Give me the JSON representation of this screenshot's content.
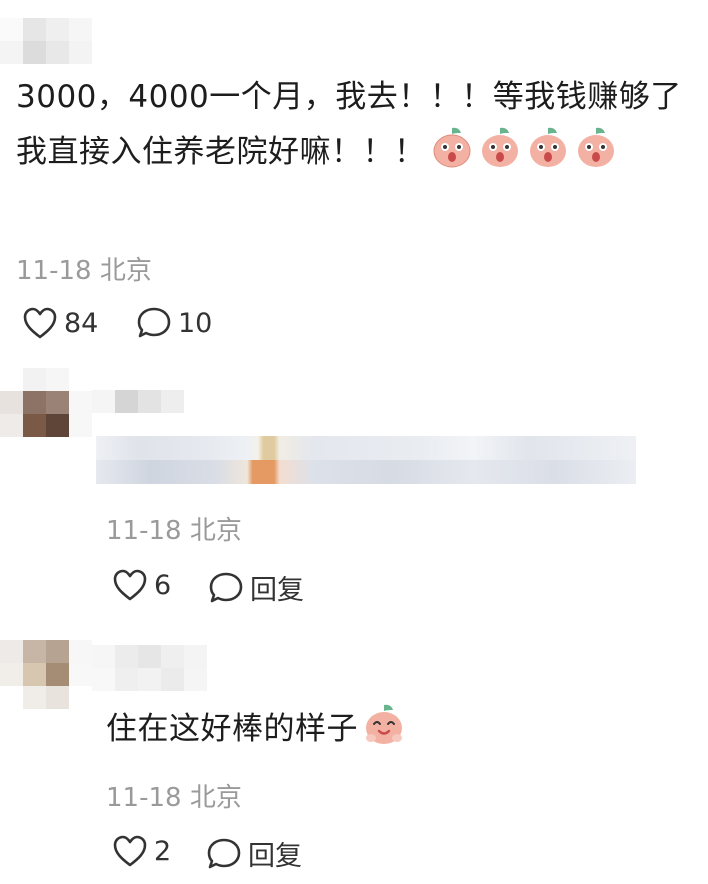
{
  "comments": [
    {
      "text": "3000，4000一个月，我去！！！等我钱赚够了我直接入住养老院好嘛！！！",
      "emoji_name": "peach-shocked-icon",
      "emoji_count": 4,
      "date": "11-18",
      "location": "北京",
      "likes": "84",
      "replies": "10"
    },
    {
      "date": "11-18",
      "location": "北京",
      "likes": "6",
      "reply_label": "回复"
    },
    {
      "text": "住在这好棒的样子",
      "emoji_name": "peach-happy-icon",
      "date": "11-18",
      "location": "北京",
      "likes": "2",
      "reply_label": "回复"
    }
  ],
  "colors": {
    "text": "#1d1d1d",
    "meta": "#9a9a9a",
    "peach": "#f3b1a3",
    "leaf": "#68b58d"
  }
}
